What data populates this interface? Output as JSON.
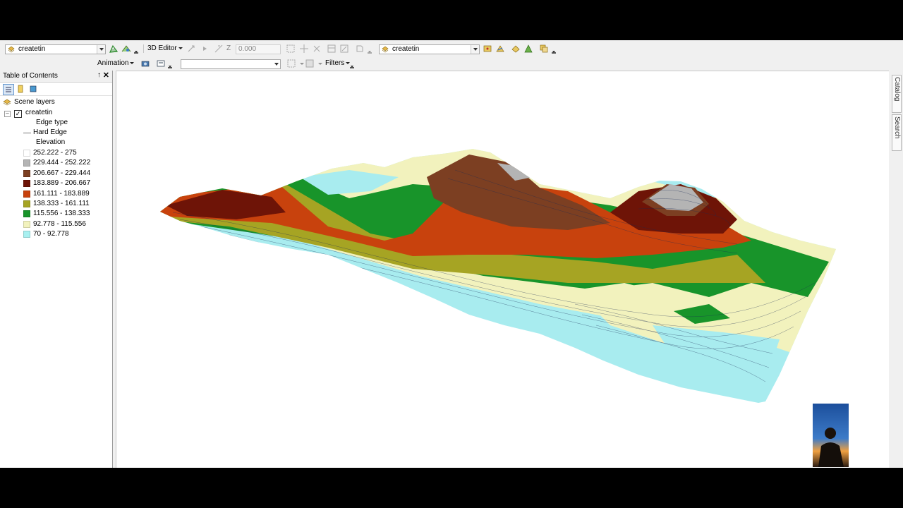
{
  "toolbar": {
    "layer_combo_left": "createtin",
    "editor_menu": "3D Editor",
    "z_value": "0.000",
    "layer_combo_right": "createtin",
    "animation_menu": "Animation",
    "filters_menu": "Filters",
    "search_combo_value": ""
  },
  "toc": {
    "title": "Table of Contents",
    "pin": "↑",
    "close": "✕",
    "root": "Scene layers",
    "layer": "createtin",
    "layer_checked": true,
    "edge_heading": "Edge type",
    "edge_item": "Hard Edge",
    "elevation_heading": "Elevation",
    "classes": [
      {
        "label": "252.222 - 275",
        "color": "#ffffff"
      },
      {
        "label": "229.444 - 252.222",
        "color": "#b4b4b4"
      },
      {
        "label": "206.667 - 229.444",
        "color": "#7c3f22"
      },
      {
        "label": "183.889 - 206.667",
        "color": "#6e1407"
      },
      {
        "label": "161.111 - 183.889",
        "color": "#c8420d"
      },
      {
        "label": "138.333 - 161.111",
        "color": "#a6a423"
      },
      {
        "label": "115.556 - 138.333",
        "color": "#18942a"
      },
      {
        "label": "92.778 - 115.556",
        "color": "#f2f2bd"
      },
      {
        "label": "70 - 92.778",
        "color": "#a8f0f0"
      }
    ]
  },
  "dock": {
    "catalog": "Catalog",
    "search": "Search"
  },
  "icons": {
    "layer": "layer-icon",
    "tin": "tin-icon",
    "camera": "camera-icon",
    "clip": "clip-icon"
  }
}
